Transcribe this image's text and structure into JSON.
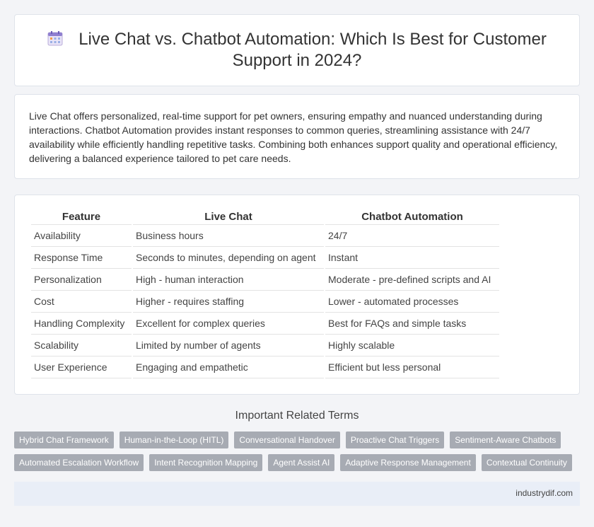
{
  "header": {
    "title": "Live Chat vs. Chatbot Automation: Which Is Best for Customer Support in 2024?",
    "icon": "calendar-icon"
  },
  "intro": {
    "text": "Live Chat offers personalized, real-time support for pet owners, ensuring empathy and nuanced understanding during interactions. Chatbot Automation provides instant responses to common queries, streamlining assistance with 24/7 availability while efficiently handling repetitive tasks. Combining both enhances support quality and operational efficiency, delivering a balanced experience tailored to pet care needs."
  },
  "table": {
    "headers": [
      "Feature",
      "Live Chat",
      "Chatbot Automation"
    ],
    "rows": [
      [
        "Availability",
        "Business hours",
        "24/7"
      ],
      [
        "Response Time",
        "Seconds to minutes, depending on agent",
        "Instant"
      ],
      [
        "Personalization",
        "High - human interaction",
        "Moderate - pre-defined scripts and AI"
      ],
      [
        "Cost",
        "Higher - requires staffing",
        "Lower - automated processes"
      ],
      [
        "Handling Complexity",
        "Excellent for complex queries",
        "Best for FAQs and simple tasks"
      ],
      [
        "Scalability",
        "Limited by number of agents",
        "Highly scalable"
      ],
      [
        "User Experience",
        "Engaging and empathetic",
        "Efficient but less personal"
      ]
    ]
  },
  "related": {
    "title": "Important Related Terms",
    "rows": [
      [
        "Hybrid Chat Framework",
        "Human-in-the-Loop (HITL)",
        "Conversational Handover",
        "Proactive Chat Triggers",
        "Sentiment-Aware Chatbots"
      ],
      [
        "Automated Escalation Workflow",
        "Intent Recognition Mapping",
        "Agent Assist AI",
        "Adaptive Response Management",
        "Contextual Continuity"
      ]
    ]
  },
  "footer": {
    "site": "industrydif.com"
  }
}
